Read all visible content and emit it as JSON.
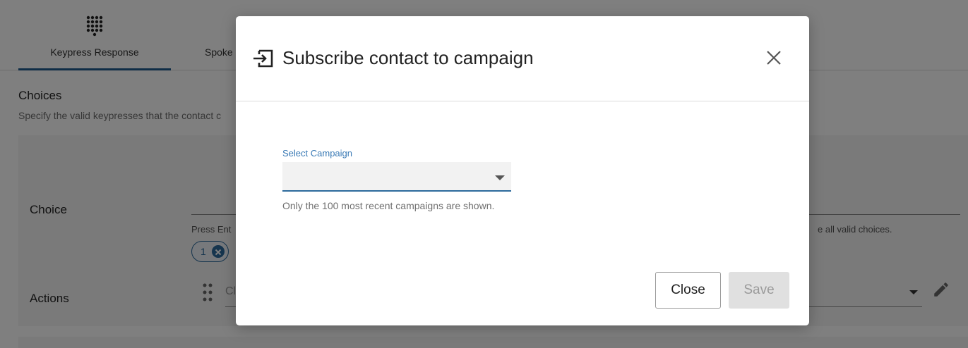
{
  "tabs": [
    {
      "label": "Keypress Response",
      "icon": "dialpad-icon",
      "active": true
    },
    {
      "label": "Spoke",
      "icon": "",
      "active": false
    }
  ],
  "choices_section": {
    "title": "Choices",
    "description": "Specify the valid keypresses that the contact c"
  },
  "panel": {
    "choice_label": "Choice",
    "choice_helper_start": "Press Ent",
    "choice_helper_end": "e all valid choices.",
    "chips": [
      "1"
    ],
    "actions_label": "Actions",
    "action_placeholder": "Cl"
  },
  "modal": {
    "title": "Subscribe contact to campaign",
    "title_icon": "enter-arrow-icon",
    "close_icon": "close-icon",
    "field_label": "Select Campaign",
    "selected_value": "",
    "helper_text": "Only the 100 most recent campaigns are shown.",
    "close_button": "Close",
    "save_button": "Save"
  },
  "colors": {
    "accent": "#2d6a9c",
    "label_blue": "#3a7ab5",
    "disabled_bg": "#e0e0e0"
  }
}
